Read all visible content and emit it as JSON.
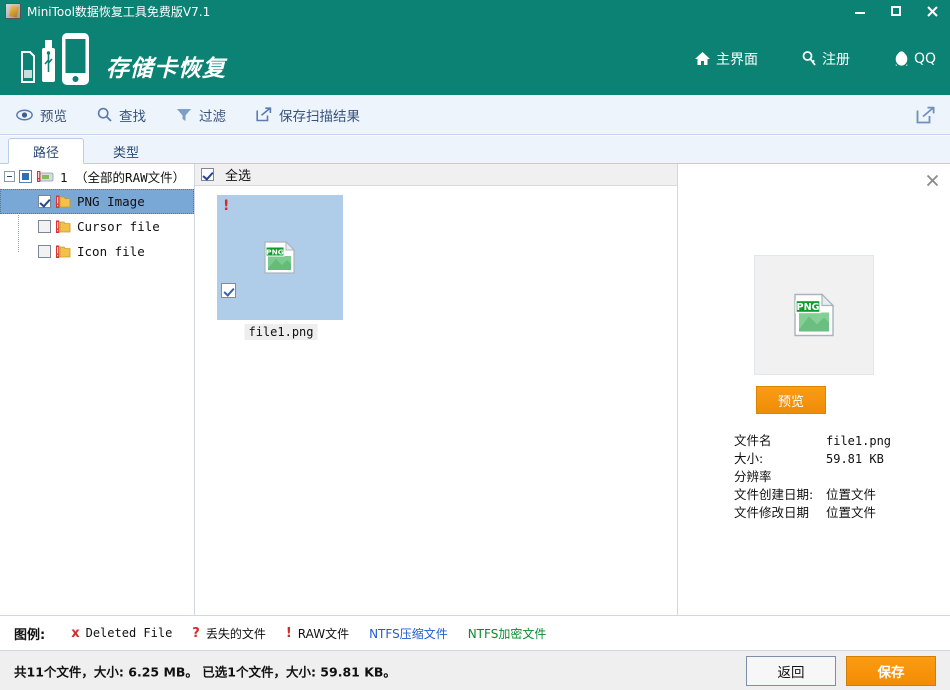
{
  "window": {
    "title": "MiniTool数据恢复工具免费版V7.1",
    "app_icon": "disk-repair-icon",
    "minimize_label": "最小化",
    "maximize_label": "最大化",
    "close_label": "关闭"
  },
  "brand": {
    "title": "存储卡恢复",
    "logo": "memory-card-usb-phone-icon",
    "accent_color": "#0b8274",
    "nav": [
      {
        "label": "主界面",
        "icon": "home-icon"
      },
      {
        "label": "注册",
        "icon": "key-icon"
      },
      {
        "label": "QQ",
        "icon": "qq-penguin-icon"
      }
    ]
  },
  "toolbar": {
    "items": [
      {
        "label": "预览",
        "icon": "eye-icon"
      },
      {
        "label": "查找",
        "icon": "search-icon"
      },
      {
        "label": "过滤",
        "icon": "funnel-icon"
      },
      {
        "label": "保存扫描结果",
        "icon": "export-box-icon"
      }
    ],
    "export_icon": "share-export-icon"
  },
  "tabs": [
    {
      "label": "路径",
      "active": true
    },
    {
      "label": "类型",
      "active": false
    }
  ],
  "tree": {
    "root": {
      "label": "1 （全部的RAW文件）",
      "expander": "collapse-minus-icon",
      "checkbox_state": "partial",
      "drive_icon": "raw-drive-icon"
    },
    "children": [
      {
        "label": "PNG Image",
        "checkbox_state": "checked",
        "selected": true,
        "icon": "raw-folder-icon"
      },
      {
        "label": "Cursor file",
        "checkbox_state": "unchecked",
        "selected": false,
        "icon": "raw-folder-icon"
      },
      {
        "label": "Icon file",
        "checkbox_state": "unchecked",
        "selected": false,
        "icon": "raw-folder-icon"
      }
    ]
  },
  "file_list": {
    "select_all_label": "全选",
    "select_all_checked": true,
    "items": [
      {
        "name": "file1.png",
        "checked": true,
        "marker": "!",
        "marker_meaning": "RAW文件",
        "thumb_icon": "png-file-icon",
        "selected": true
      }
    ]
  },
  "preview": {
    "close_icon": "close-icon",
    "thumbnail_icon": "png-file-icon",
    "preview_button": "预览",
    "fields": [
      {
        "key": "文件名",
        "value": "file1.png",
        "mono": true
      },
      {
        "key": "大小:",
        "value": "59.81 KB",
        "mono": true
      },
      {
        "key": "分辨率",
        "value": "",
        "mono": true
      },
      {
        "key": "文件创建日期:",
        "value": "位置文件",
        "mono": false
      },
      {
        "key": "文件修改日期",
        "value": "位置文件",
        "mono": false
      }
    ]
  },
  "legend": {
    "title": "图例:",
    "items": [
      {
        "mark": "x",
        "label": "Deleted File",
        "style": "mono-red-mark"
      },
      {
        "mark": "?",
        "label": "丢失的文件",
        "style": "red-mark"
      },
      {
        "mark": "!",
        "label": "RAW文件",
        "style": "red-mark"
      },
      {
        "mark": "",
        "label": "NTFS压缩文件",
        "style": "blue-text"
      },
      {
        "mark": "",
        "label": "NTFS加密文件",
        "style": "green-text"
      }
    ]
  },
  "status": {
    "text": "共11个文件，大小: 6.25 MB。 已选1个文件，大小: 59.81 KB。",
    "total_files": "11",
    "total_size": "6.25 MB",
    "selected_files": "1",
    "selected_size": "59.81 KB",
    "back_button": "返回",
    "save_button": "保存"
  }
}
